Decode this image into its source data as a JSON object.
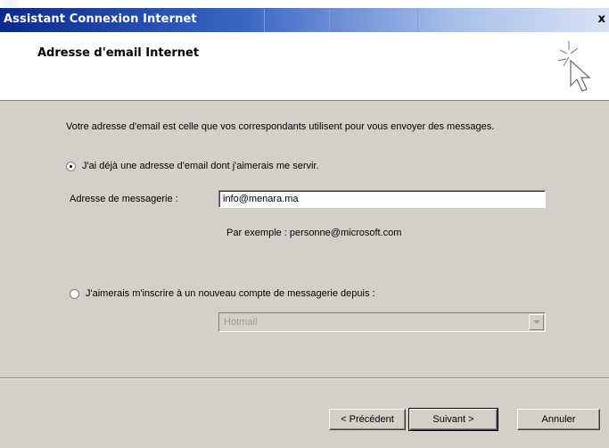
{
  "window": {
    "title": "Assistant Connexion Internet",
    "close_symbol": "x"
  },
  "header": {
    "title": "Adresse d'email Internet",
    "icon": "wizard-sparkle-cursor-icon"
  },
  "body": {
    "intro": "Votre adresse d'email est celle que vos correspondants utilisent pour vous envoyer des messages."
  },
  "option_existing": {
    "label": "J'ai déjà une adresse d'email dont j'aimerais me servir.",
    "checked": true
  },
  "email_field": {
    "label": "Adresse de messagerie :",
    "value": "info@menara.ma",
    "example": "Par exemple : personne@microsoft.com"
  },
  "option_new": {
    "label": "J'aimerais m'inscrire à un nouveau compte de messagerie depuis :",
    "checked": false
  },
  "provider_select": {
    "value": "Hotmail"
  },
  "buttons": {
    "back": "< Précédent",
    "next": "Suivant >",
    "cancel": "Annuler"
  }
}
